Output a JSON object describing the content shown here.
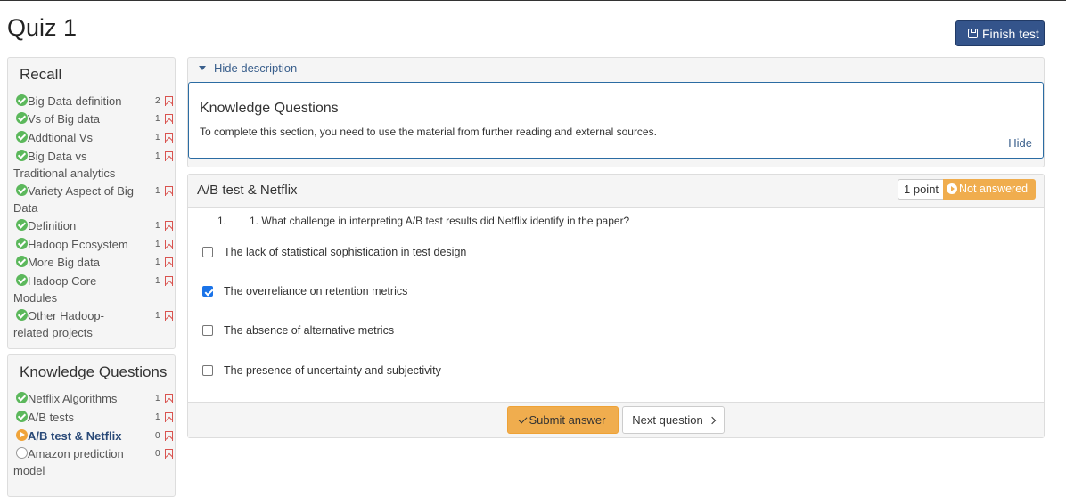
{
  "page": {
    "title": "Quiz 1",
    "finish_label": "Finish test"
  },
  "recall": {
    "title": "Recall",
    "items": [
      {
        "label": "Big Data definition",
        "count": "2",
        "status": "done"
      },
      {
        "label": "Vs of Big data",
        "count": "1",
        "status": "done"
      },
      {
        "label": "Addtional Vs",
        "count": "1",
        "status": "done"
      },
      {
        "label": "Big Data vs Traditional analytics",
        "count": "1",
        "status": "done"
      },
      {
        "label": "Variety Aspect of Big Data",
        "count": "1",
        "status": "done"
      },
      {
        "label": "Definition",
        "count": "1",
        "status": "done"
      },
      {
        "label": "Hadoop Ecosystem",
        "count": "1",
        "status": "done"
      },
      {
        "label": "More Big data",
        "count": "1",
        "status": "done"
      },
      {
        "label": "Hadoop Core Modules",
        "count": "1",
        "status": "done"
      },
      {
        "label": "Other Hadoop-related projects",
        "count": "1",
        "status": "done"
      }
    ]
  },
  "knowledge": {
    "title": "Knowledge Questions",
    "items": [
      {
        "label": "Netflix Algorithms",
        "count": "1",
        "status": "done"
      },
      {
        "label": "A/B tests",
        "count": "1",
        "status": "done"
      },
      {
        "label": "A/B test & Netflix",
        "count": "0",
        "status": "current"
      },
      {
        "label": "Amazon prediction model",
        "count": "0",
        "status": "todo"
      }
    ]
  },
  "description": {
    "toggle_label": "Hide description",
    "title": "Knowledge Questions",
    "text": "To complete this section, you need to use the material from further reading and external sources.",
    "hide_label": "Hide"
  },
  "question": {
    "title": "A/B test & Netflix",
    "points": "1 point",
    "status": "Not answered",
    "number": "1.",
    "text": "1. What challenge in interpreting A/B test results did Netflix identify in the paper?",
    "options": [
      {
        "label": "The lack of statistical sophistication in test design",
        "checked": false
      },
      {
        "label": "The overreliance on retention metrics",
        "checked": true
      },
      {
        "label": "The absence of alternative metrics",
        "checked": false
      },
      {
        "label": "The presence of uncertainty and subjectivity",
        "checked": false
      }
    ],
    "submit_label": "Submit answer",
    "next_label": "Next question"
  }
}
